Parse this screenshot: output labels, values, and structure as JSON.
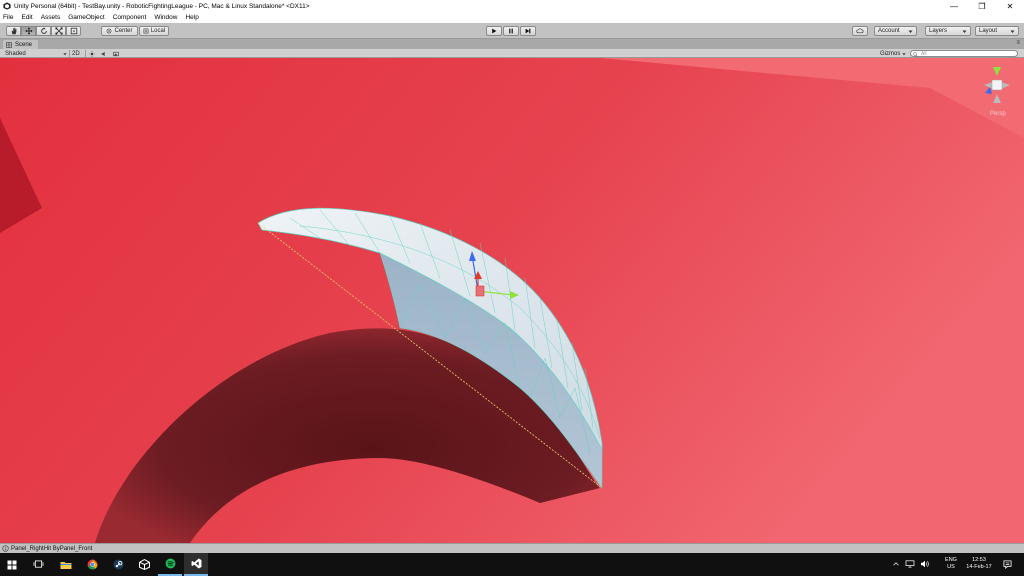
{
  "window": {
    "title": "Unity Personal (64bit) - TestBay.unity - RoboticFightingLeague - PC, Mac & Linux Standalone* <DX11>",
    "controls": {
      "minimize": "—",
      "maximize": "❐",
      "close": "✕"
    }
  },
  "menubar": {
    "items": [
      "File",
      "Edit",
      "Assets",
      "GameObject",
      "Component",
      "Window",
      "Help"
    ]
  },
  "toolbar": {
    "tools": [
      "hand-tool",
      "move-tool",
      "rotate-tool",
      "scale-tool",
      "rect-tool"
    ],
    "active_tool": "move-tool",
    "pivot_label": "Center",
    "space_label": "Local",
    "account_label": "Account",
    "layers_label": "Layers",
    "layout_label": "Layout"
  },
  "scene": {
    "tab_label": "Scene",
    "shading_mode": "Shaded",
    "mode_2d": "2D",
    "gizmos_label": "Gizmos",
    "search_placeholder": "All",
    "projection_label": "Persp",
    "colors": {
      "floor": "#e4404c",
      "floor_far": "#f26a72",
      "shadow": "#6a1a20",
      "mesh": "#c6d7e4",
      "wire": "#4fd6c8"
    }
  },
  "status": {
    "message": "Panel_RightHit ByPanel_Front"
  },
  "taskbar": {
    "apps": [
      "windows-start",
      "task-view",
      "file-explorer",
      "chrome",
      "steam",
      "unity-hub",
      "spotify",
      "visual-studio"
    ],
    "language": "ENG",
    "region": "US",
    "time": "12:53",
    "date": "14-Feb-17"
  }
}
